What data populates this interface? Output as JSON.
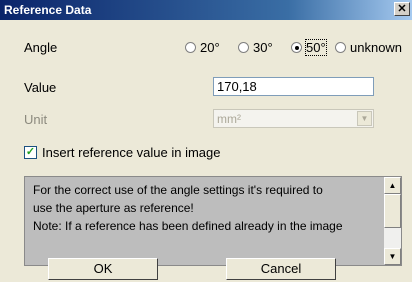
{
  "window": {
    "title": "Reference Data",
    "close_label": "✕"
  },
  "angle": {
    "label": "Angle",
    "options": [
      {
        "label": "20°",
        "checked": false
      },
      {
        "label": "30°",
        "checked": false
      },
      {
        "label": "50°",
        "checked": true
      },
      {
        "label": "unknown",
        "checked": false
      }
    ]
  },
  "value": {
    "label": "Value",
    "input_value": "170,18"
  },
  "unit": {
    "label": "Unit",
    "selected": "mm²"
  },
  "insert_checkbox": {
    "label": "Insert reference value in image",
    "checked": true
  },
  "note": {
    "lines": [
      "For the correct use of the angle settings it's required to",
      "use the aperture as reference!",
      "Note: If a reference has been defined already in the image"
    ]
  },
  "buttons": {
    "ok": "OK",
    "cancel": "Cancel"
  }
}
